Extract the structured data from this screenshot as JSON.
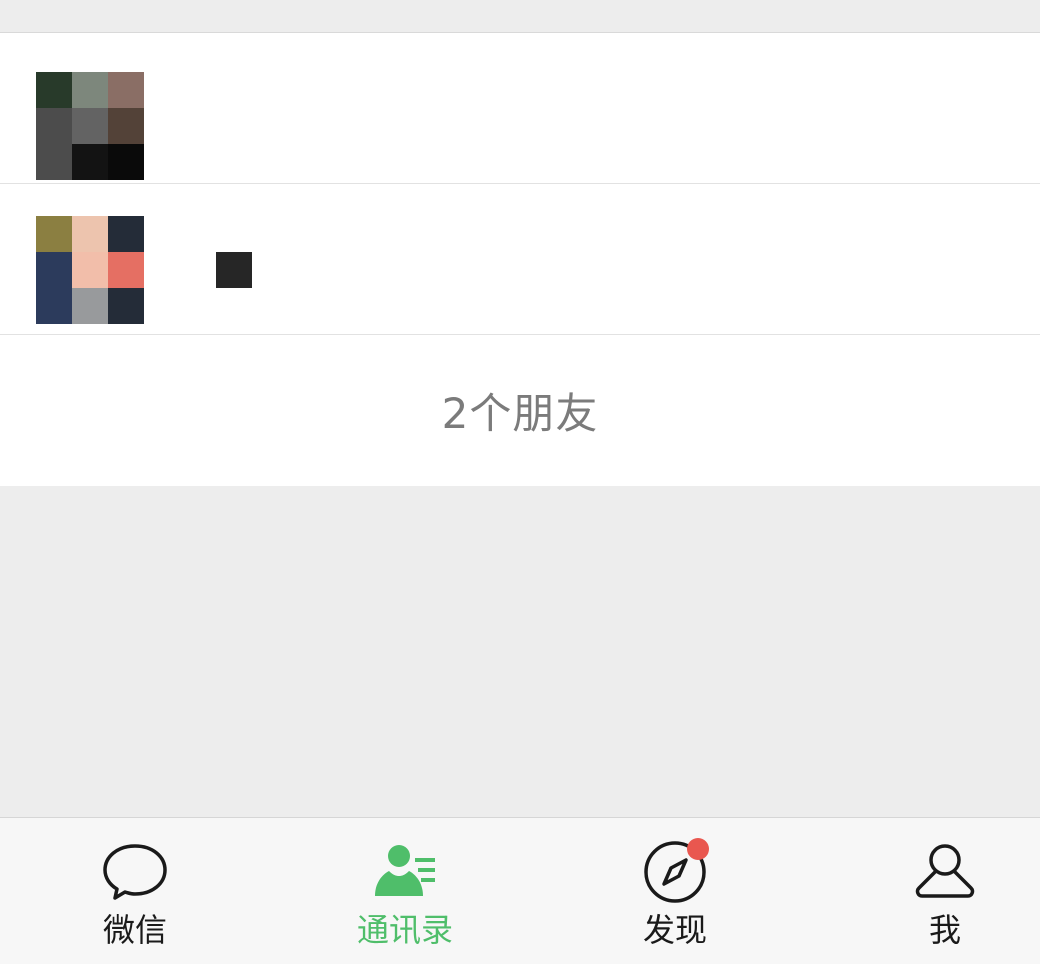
{
  "contacts": [
    {
      "avatar_colors": [
        "#283a2a",
        "#7d877c",
        "#8a6e65",
        "#4c4c4c",
        "#636363",
        "#534238",
        "#4c4c4c",
        "#131313",
        "#0a0a0a"
      ]
    },
    {
      "avatar_colors": [
        "#8b7f41",
        "#edc4ae",
        "#242c38",
        "#2c3b5c",
        "#f2beaa",
        "#e56f63",
        "#2c3b5c",
        "#989a9c",
        "#242c38"
      ]
    }
  ],
  "footer": {
    "count_text": "2个朋友"
  },
  "tabbar": {
    "active": "contacts",
    "accent_color": "#4fbe6a",
    "badge_color": "#e9574f",
    "tabs": [
      {
        "id": "chats",
        "label": "微信",
        "icon": "chat-bubble-icon"
      },
      {
        "id": "contacts",
        "label": "通讯录",
        "icon": "contacts-icon"
      },
      {
        "id": "discover",
        "label": "发现",
        "icon": "compass-icon",
        "badge": true
      },
      {
        "id": "me",
        "label": "我",
        "icon": "person-icon"
      }
    ]
  }
}
